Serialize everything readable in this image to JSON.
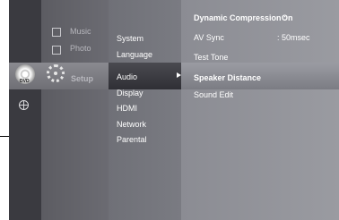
{
  "top_menu": {
    "music": "Music",
    "photo": "Photo",
    "setup": "Setup"
  },
  "setup_menu": {
    "items": [
      "System",
      "Language",
      "Audio",
      "Display",
      "HDMI",
      "Network",
      "Parental"
    ],
    "selected": "Audio"
  },
  "audio_menu": {
    "dynamic_compression_label": "Dynamic Compression :",
    "dynamic_compression_value": "On",
    "av_sync_label": "AV Sync",
    "av_sync_value": ": 50msec",
    "items": [
      "Test Tone",
      "Speaker Distance",
      "Sound Edit"
    ]
  },
  "icons": {
    "disc": "dvd-disc-icon",
    "setup": "gear-icon",
    "network": "globe-icon",
    "music": "music-icon",
    "photo": "photo-icon"
  },
  "disc_label": "DVD"
}
